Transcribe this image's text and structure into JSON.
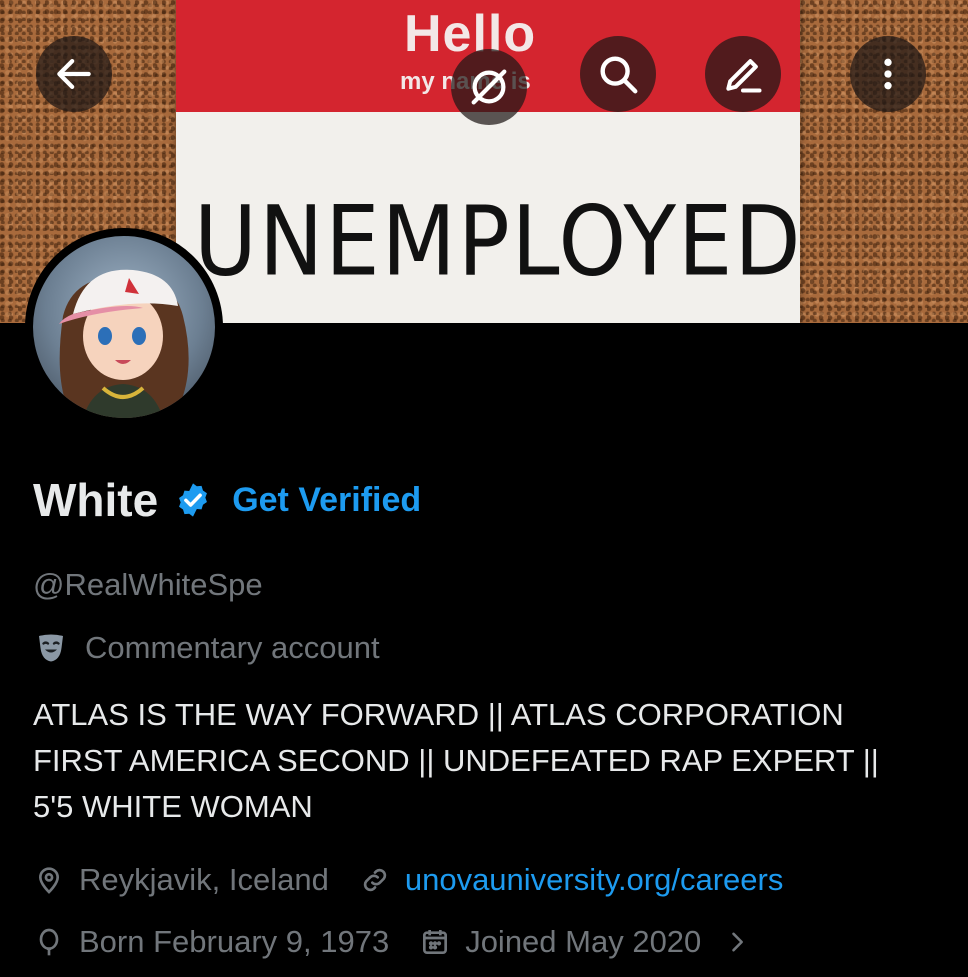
{
  "banner": {
    "sticker_hello": "Hello",
    "sticker_sub": "my name is",
    "sticker_word": "UNEMPLOYED"
  },
  "controls": {
    "back": "arrow-left-icon",
    "grok": "grok-icon",
    "search": "search-icon",
    "edit": "pencil-icon",
    "more": "more-vertical-icon"
  },
  "profile": {
    "name": "White",
    "get_verified": "Get Verified",
    "handle": "@RealWhiteSpe",
    "category": "Commentary account",
    "bio": [
      "ATLAS IS THE WAY FORWARD || ATLAS CORPORATION",
      "FIRST AMERICA SECOND || UNDEFEATED RAP EXPERT ||",
      "5'5 WHITE WOMAN"
    ],
    "location": "Reykjavik, Iceland",
    "website": "unovauniversity.org/careers",
    "born": "Born February 9, 1973",
    "joined": "Joined May 2020"
  },
  "colors": {
    "accent": "#1d9bf0",
    "muted": "#71767b",
    "text": "#e7e9ea",
    "background": "#000000"
  }
}
